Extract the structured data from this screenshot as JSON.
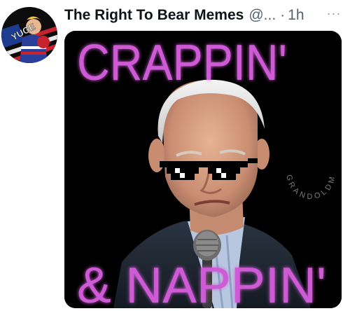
{
  "tweet": {
    "display_name": "The Right To Bear Memes",
    "handle": "@...",
    "separator": "·",
    "timestamp": "1h",
    "more_label": "···",
    "avatar": {
      "badge_text": "YUGE"
    },
    "media": {
      "top_text": "CRAPPIN'",
      "bottom_text": "& NAPPIN'",
      "watermark": "GRANDOLDMEMES",
      "neon_color": "#cf5ad6"
    }
  }
}
